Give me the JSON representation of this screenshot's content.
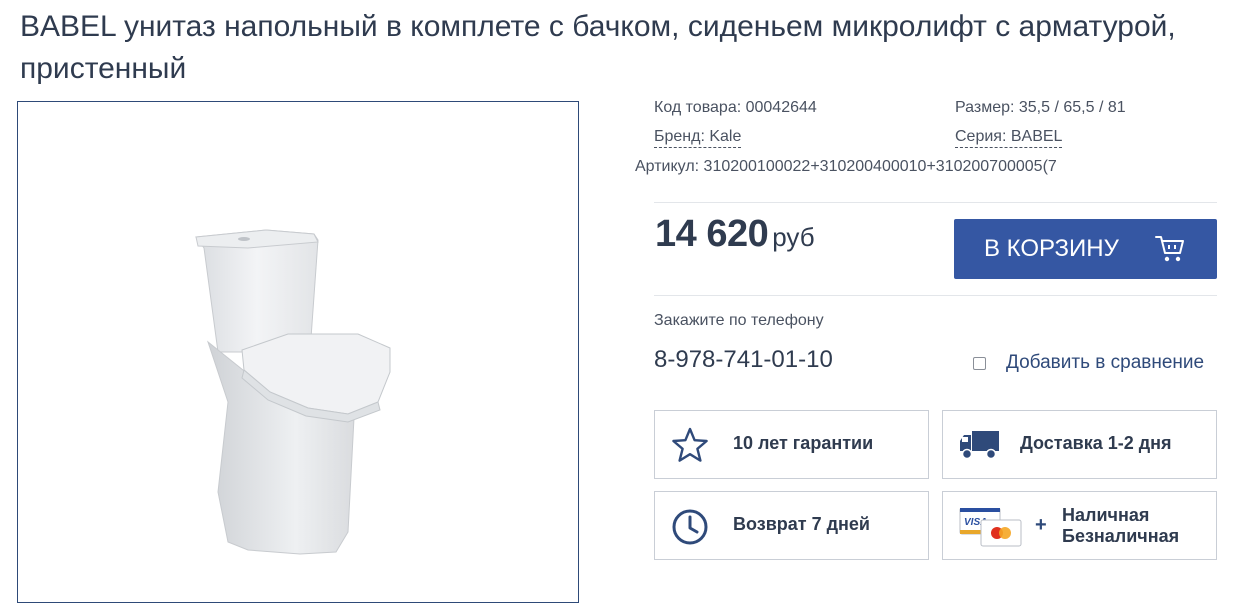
{
  "product": {
    "title": "BABEL унитаз напольный в комплете с бачком, сиденьем микролифт с арматурой, пристенный"
  },
  "meta": {
    "code": "Код товара: 00042644",
    "size": "Размер: 35,5 / 65,5 / 81",
    "brand_label": "Бренд: ",
    "brand_value": "Kale",
    "series_label": "Серия: ",
    "series_value": "BABEL",
    "article": "Артикул: 310200100022+310200400010+310200700005(7"
  },
  "price": {
    "amount": "14 620",
    "currency": "руб"
  },
  "cart": {
    "label": "В КОРЗИНУ",
    "icon": "cart-icon"
  },
  "contact": {
    "caption": "Закажите по телефону",
    "phone": "8-978-741-01-10"
  },
  "compare": {
    "label": "Добавить в сравнение",
    "checked": false
  },
  "features": {
    "warranty": "10 лет гарантии",
    "delivery": "Доставка 1-2 дня",
    "return": "Возврат 7 дней",
    "payment_plus": "+",
    "payment_cash": "Наличная",
    "payment_card": "Безналичная"
  },
  "icons": {
    "warranty": "star-icon",
    "delivery": "truck-icon",
    "return": "clock-icon",
    "payment": "payment-cards-icon"
  },
  "colors": {
    "accent": "#3557a3",
    "text": "#2f3b4f",
    "border": "#c9ced6"
  }
}
